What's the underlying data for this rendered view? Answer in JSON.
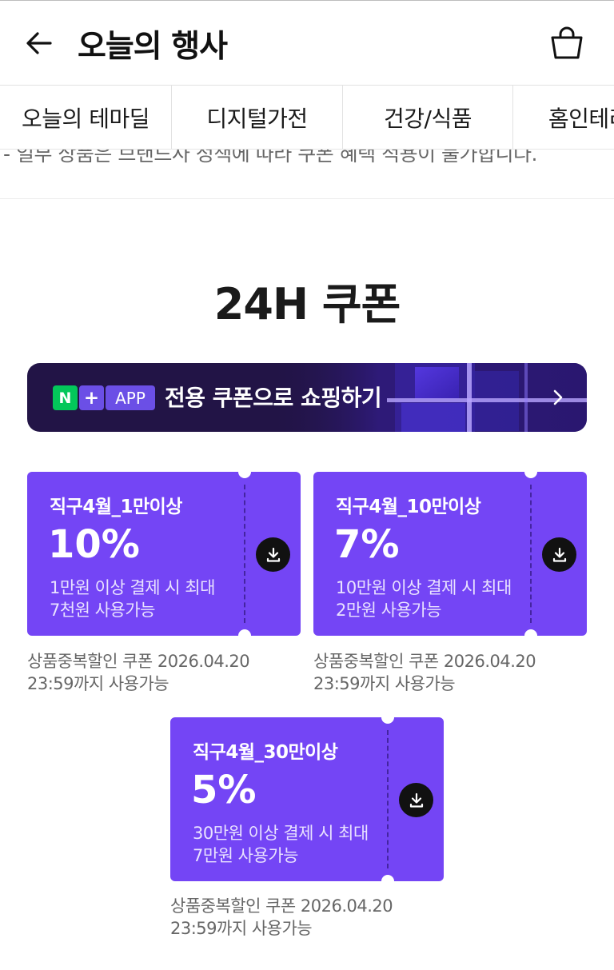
{
  "header": {
    "title": "오늘의 행사",
    "back_icon": "arrow-left-icon",
    "cart_icon": "shopping-bag-icon"
  },
  "tabs": [
    "오늘의 테마딜",
    "디지털가전",
    "건강/식품",
    "홈인테리어"
  ],
  "notice": "- 일부 상품은 브랜드사 정책에 따라 쿠폰 혜택 적용이 불가합니다.",
  "section": {
    "title": "24H 쿠폰"
  },
  "banner": {
    "badge_n": "N",
    "badge_plus": "+",
    "badge_app": "APP",
    "text": "전용 쿠폰으로 쇼핑하기",
    "bg_color": "#221446",
    "accent_color": "#6b4fe6",
    "n_color": "#03c75a"
  },
  "coupons": [
    {
      "name": "직구4월_1만이상",
      "rate": "10%",
      "desc_line1": "1만원 이상 결제 시 최대",
      "desc_line2": "7천원 사용가능",
      "note_line1": "상품중복할인 쿠폰 2026.04.20",
      "note_line2": "23:59까지 사용가능"
    },
    {
      "name": "직구4월_10만이상",
      "rate": "7%",
      "desc_line1": "10만원 이상 결제 시 최대",
      "desc_line2": "2만원 사용가능",
      "note_line1": "상품중복할인 쿠폰 2026.04.20",
      "note_line2": "23:59까지 사용가능"
    },
    {
      "name": "직구4월_30만이상",
      "rate": "5%",
      "desc_line1": "30만원 이상 결제 시 최대",
      "desc_line2": "7만원 사용가능",
      "note_line1": "상품중복할인 쿠폰 2026.04.20",
      "note_line2": "23:59까지 사용가능"
    }
  ],
  "colors": {
    "coupon_bg": "#7445f5",
    "download_btn": "#111111"
  }
}
